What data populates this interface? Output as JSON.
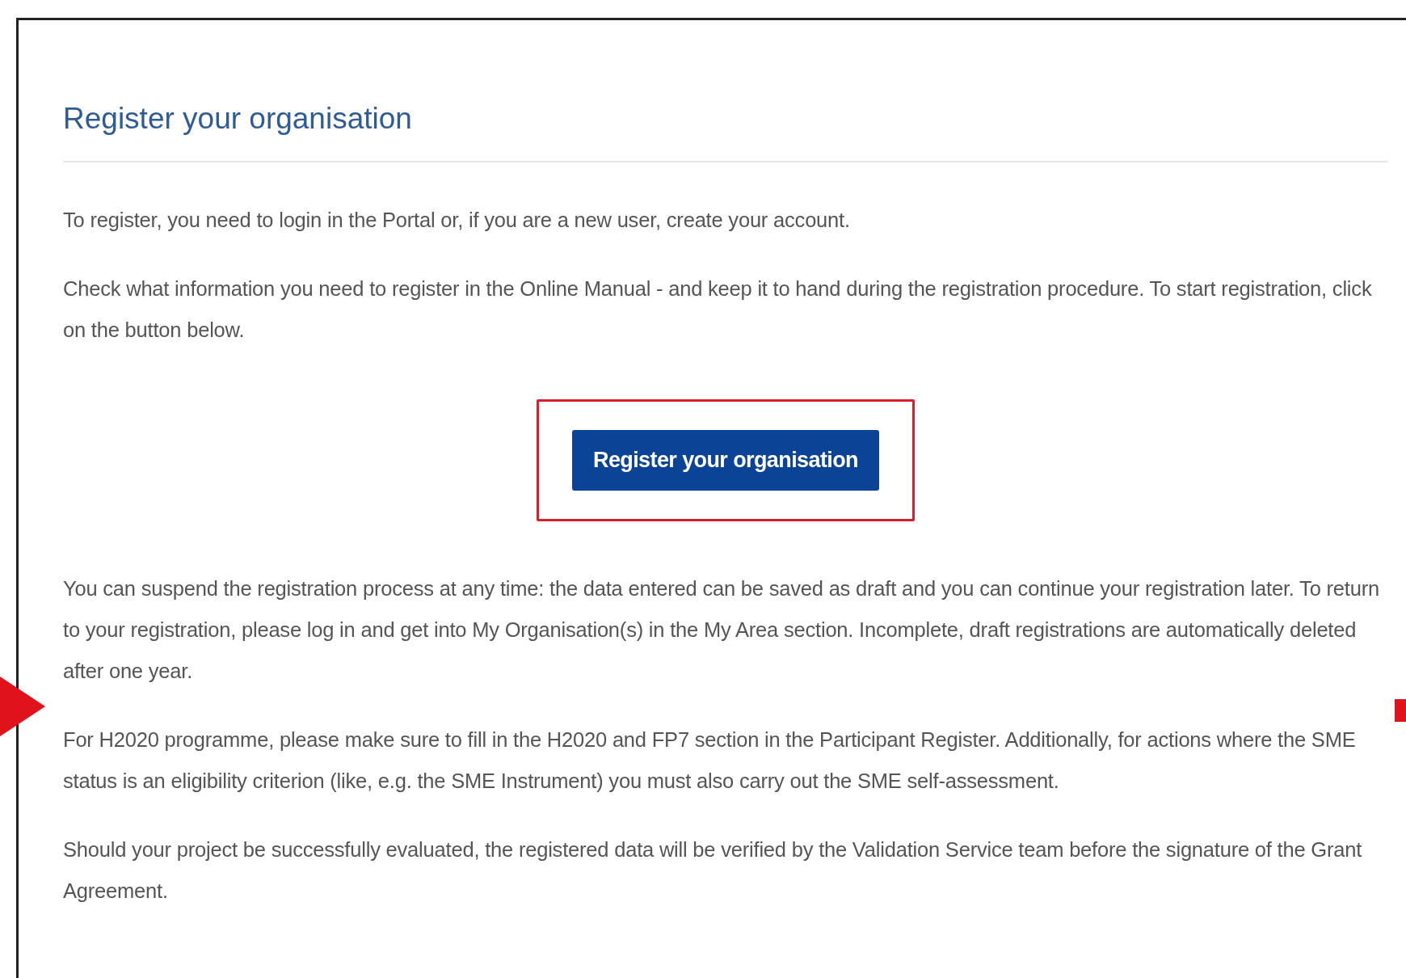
{
  "heading": "Register your organisation",
  "intro": [
    "To register, you need to login in the Portal or, if you are a new user, create your account.",
    "Check what information you need to register in the Online Manual - and keep it to hand during the registration procedure. To start registration, click on the button below."
  ],
  "button": {
    "label": "Register your organisation"
  },
  "notes": [
    "You can suspend the registration process at any time: the data entered can be saved as draft and you can continue your registration later. To return to your registration, please log in and get into My Organisation(s) in the My Area section. Incomplete, draft registrations are automatically deleted after one year.",
    "For H2020 programme, please make sure to fill in the H2020 and FP7 section in the Participant Register. Additionally, for actions where the SME status is an eligibility criterion (like, e.g. the SME Instrument) you must also carry out the SME self-assessment.",
    "Should your project be successfully evaluated, the registered data will be verified by the Validation Service team before the signature of the Grant Agreement."
  ]
}
